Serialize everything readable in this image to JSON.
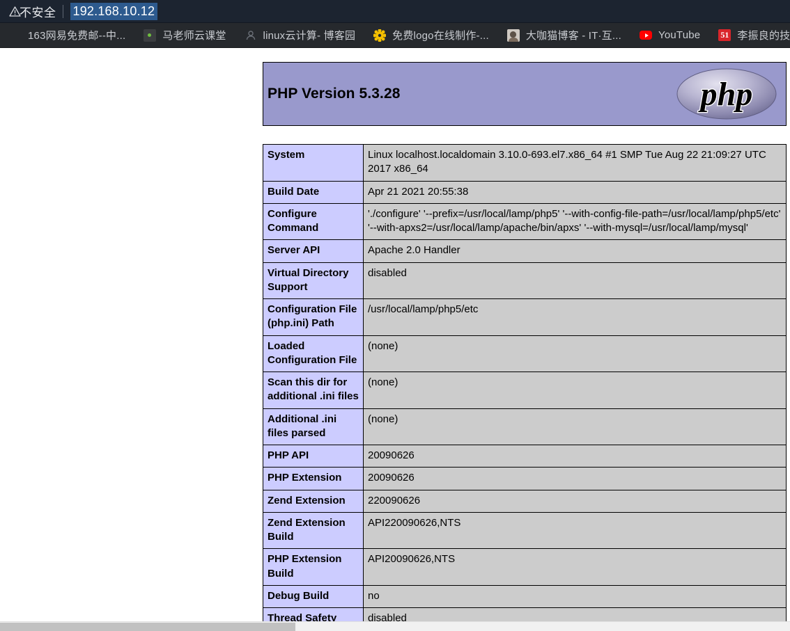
{
  "browser": {
    "security_label": "不安全",
    "security_icon": "warning-triangle-icon",
    "url": "192.168.10.12",
    "bookmarks": [
      {
        "label": "163网易免费邮--中...",
        "icon": "blank-favicon"
      },
      {
        "label": "马老师云课堂",
        "icon": "qr-code-favicon"
      },
      {
        "label": "linux云计算- 博客园",
        "icon": "person-favicon"
      },
      {
        "label": "免费logo在线制作-...",
        "icon": "gear-favicon"
      },
      {
        "label": "大咖猫博客 - IT·互...",
        "icon": "photo-favicon"
      },
      {
        "label": "YouTube",
        "icon": "youtube-favicon"
      },
      {
        "label": "李振良的技术博",
        "icon": "51-badge-favicon"
      }
    ]
  },
  "page": {
    "banner": {
      "version_title": "PHP Version 5.3.28",
      "logo_text": "php",
      "background_color": "#9999cc"
    },
    "table": {
      "key_bg": "#ccccff",
      "value_bg": "#cccccc",
      "rows": [
        {
          "key": "System",
          "value": "Linux localhost.localdomain 3.10.0-693.el7.x86_64 #1 SMP Tue Aug 22 21:09:27 UTC 2017 x86_64"
        },
        {
          "key": "Build Date",
          "value": "Apr 21 2021 20:55:38"
        },
        {
          "key": "Configure Command",
          "value": "'./configure' '--prefix=/usr/local/lamp/php5' '--with-config-file-path=/usr/local/lamp/php5/etc' '--with-apxs2=/usr/local/lamp/apache/bin/apxs' '--with-mysql=/usr/local/lamp/mysql'"
        },
        {
          "key": "Server API",
          "value": "Apache 2.0 Handler"
        },
        {
          "key": "Virtual Directory Support",
          "value": "disabled"
        },
        {
          "key": "Configuration File (php.ini) Path",
          "value": "/usr/local/lamp/php5/etc"
        },
        {
          "key": "Loaded Configuration File",
          "value": "(none)"
        },
        {
          "key": "Scan this dir for additional .ini files",
          "value": "(none)"
        },
        {
          "key": "Additional .ini files parsed",
          "value": "(none)"
        },
        {
          "key": "PHP API",
          "value": "20090626"
        },
        {
          "key": "PHP Extension",
          "value": "20090626"
        },
        {
          "key": "Zend Extension",
          "value": "220090626"
        },
        {
          "key": "Zend Extension Build",
          "value": "API220090626,NTS"
        },
        {
          "key": "PHP Extension Build",
          "value": "API20090626,NTS"
        },
        {
          "key": "Debug Build",
          "value": "no"
        },
        {
          "key": "Thread Safety",
          "value": "disabled"
        }
      ]
    }
  }
}
